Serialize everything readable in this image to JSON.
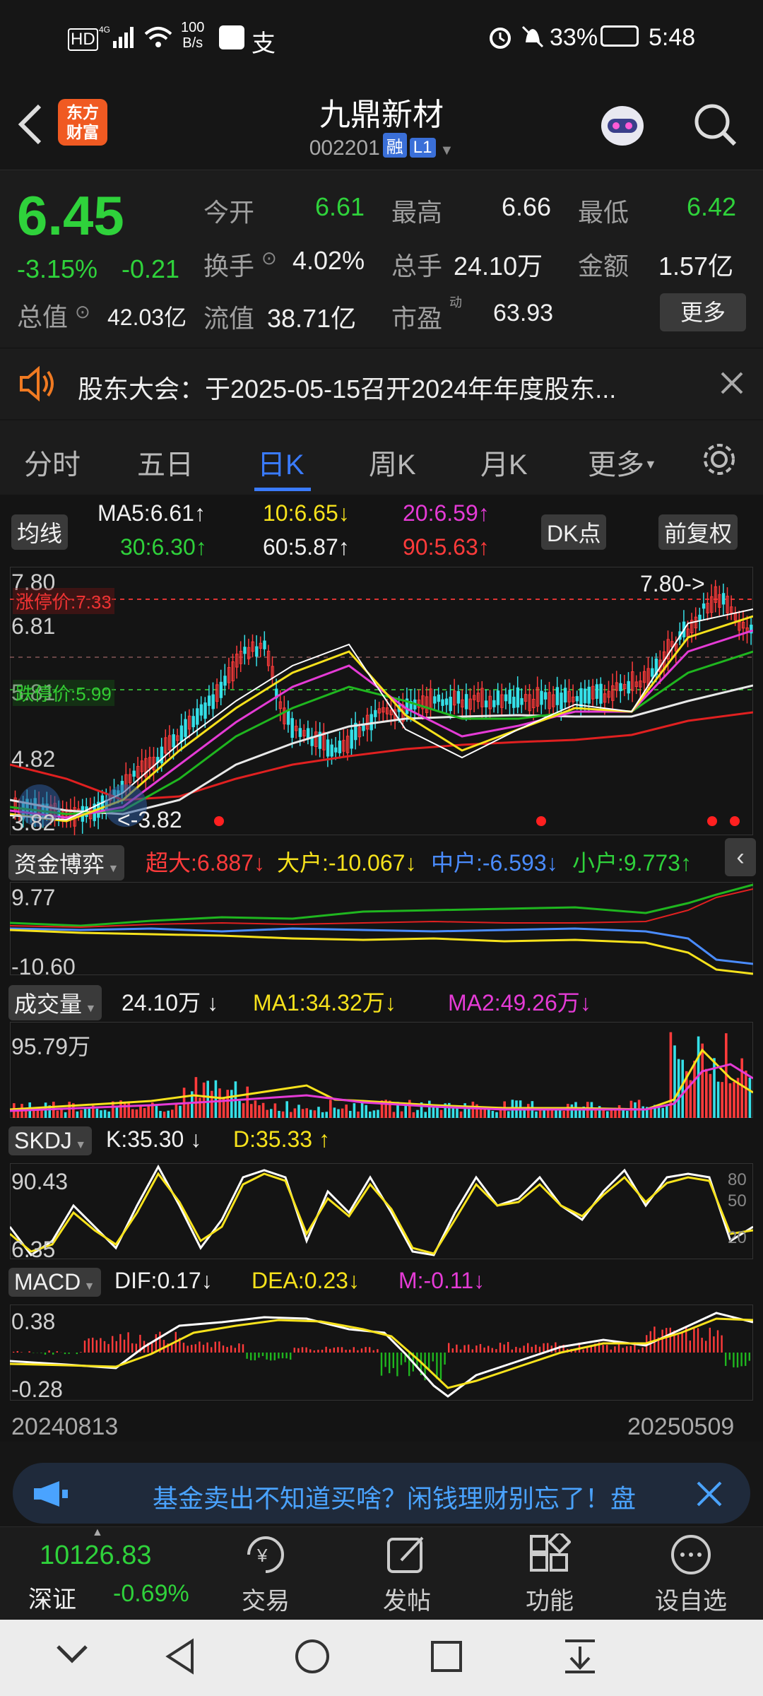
{
  "status_bar": {
    "speed": "100\nB/s",
    "speed_line1": "100",
    "speed_line2": "B/s",
    "battery": "33%",
    "time": "5:48"
  },
  "header": {
    "brand": "东方\n财富",
    "brand_line1": "东方",
    "brand_line2": "财富",
    "name": "九鼎新材",
    "code": "002201",
    "tag_margin": "融",
    "tag_level": "L1"
  },
  "quote": {
    "price": "6.45",
    "change_pct": "-3.15%",
    "change_abs": "-0.21",
    "open_label": "今开",
    "open": "6.61",
    "high_label": "最高",
    "high": "6.66",
    "low_label": "最低",
    "low": "6.42",
    "turnover_label": "换手",
    "turnover": "4.02%",
    "volume_label": "总手",
    "volume": "24.10万",
    "amount_label": "金额",
    "amount": "1.57亿",
    "mktcap_label": "总值",
    "mktcap": "42.03亿",
    "float_label": "流值",
    "float_cap": "38.71亿",
    "pe_label": "市盈",
    "pe_sup": "动",
    "pe": "63.93",
    "more": "更多"
  },
  "notice": {
    "text": "股东大会：于2025-05-15召开2024年年度股东..."
  },
  "tabs": [
    "分时",
    "五日",
    "日K",
    "周K",
    "月K",
    "更多"
  ],
  "active_tab": "日K",
  "ma_panel": {
    "label": "均线",
    "ma5": "MA5:6.61",
    "ma10": "10:6.65",
    "ma20": "20:6.59",
    "ma30": "30:6.30",
    "ma60": "60:5.87",
    "ma90": "90:5.63",
    "dk_button": "DK点",
    "adjust_button": "前复权",
    "y_top": "7.80",
    "y_2": "6.81",
    "y_3": "5.81",
    "y_4": "4.82",
    "y_bottom": "3.82",
    "limit_up": "涨停价:7.33",
    "limit_down": "跌停价:5.99",
    "max_marker": "7.80->",
    "min_marker": "<-3.82"
  },
  "fund_panel": {
    "label": "资金博弈",
    "super": "超大:6.887",
    "large": "大户:-10.067",
    "mid": "中户:-6.593",
    "small": "小户:9.773",
    "y_top": "9.77",
    "y_bottom": "-10.60"
  },
  "volume_panel": {
    "label": "成交量",
    "vol": "24.10万",
    "ma1": "MA1:34.32万",
    "ma2": "MA2:49.26万",
    "y_top": "95.79万"
  },
  "skdj_panel": {
    "label": "SKDJ",
    "k": "K:35.30",
    "d": "D:35.33",
    "y_top": "90.43",
    "y_bottom": "6.35",
    "r80": "80",
    "r50": "50",
    "r20": "20"
  },
  "macd_panel": {
    "label": "MACD",
    "dif": "DIF:0.17",
    "dea": "DEA:0.23",
    "m": "M:-0.11",
    "y_top": "0.38",
    "y_bottom": "-0.28"
  },
  "date_range": {
    "start": "20240813",
    "end": "20250509"
  },
  "banner": {
    "text": "基金卖出不知道买啥？闲钱理财别忘了！盘"
  },
  "toolbar": {
    "index_value": "10126.83",
    "index_name": "深证",
    "index_change": "-0.69%",
    "trade": "交易",
    "post": "发帖",
    "functions": "功能",
    "watchlist": "设自选"
  },
  "colors": {
    "up": "#ff3b3b",
    "down": "#2fd23b",
    "accent": "#3a7bff",
    "ma10": "#f7e21c",
    "ma20": "#e53bd6"
  }
}
